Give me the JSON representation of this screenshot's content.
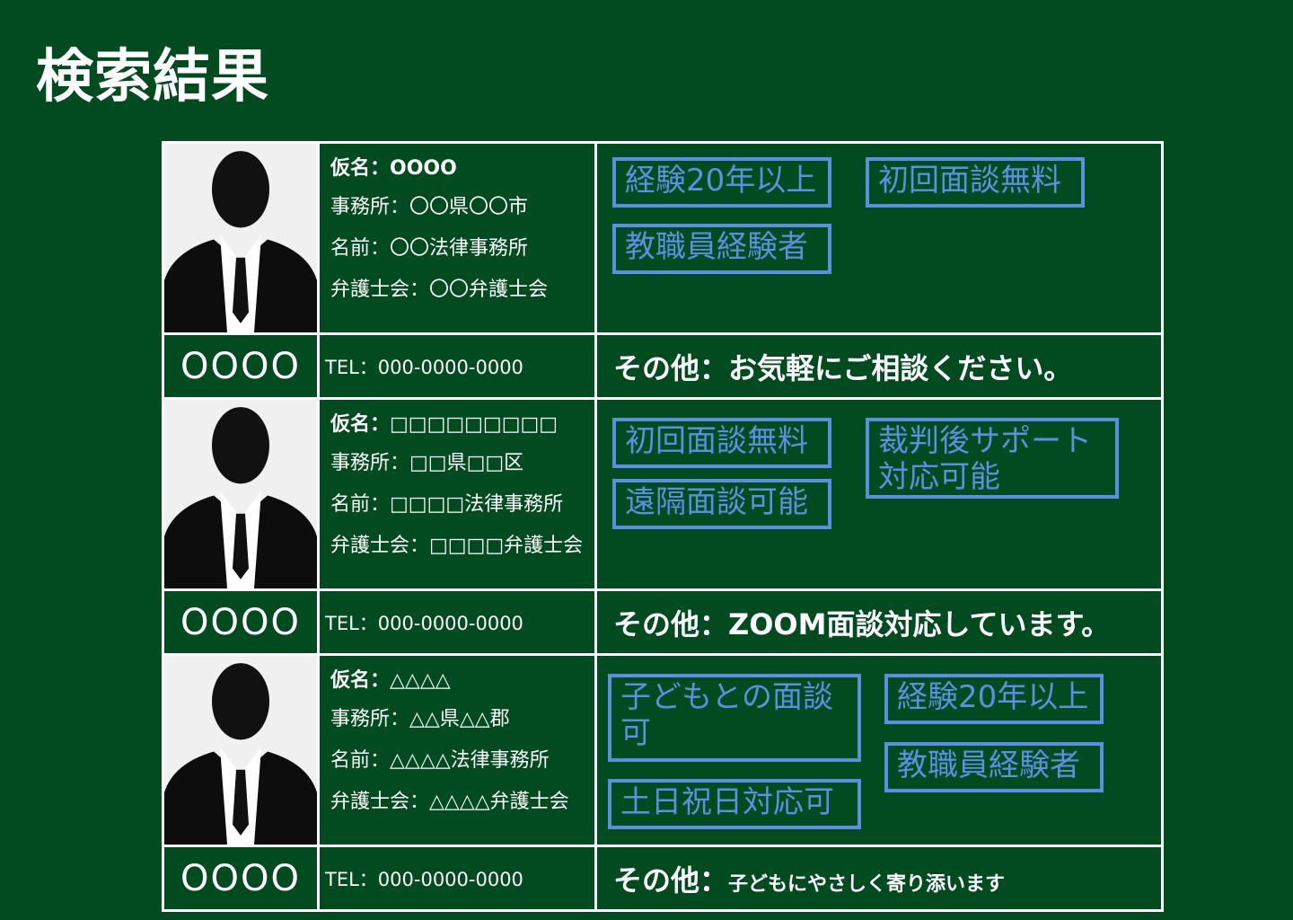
{
  "page_title": "検索結果",
  "colors": {
    "background": "#024a1f",
    "tag_border": "#5b8fe0",
    "table_border": "#ffffff"
  },
  "results": [
    {
      "alias": "仮名：OOOO",
      "office": "事務所：〇〇県〇〇市",
      "firm": "名前：〇〇法律事務所",
      "bar_association": "弁護士会：〇〇弁護士会",
      "tags": [
        "経験20年以上",
        "初回面談無料",
        "教職員経験者"
      ],
      "name": "OOOO",
      "tel": "TEL：000-0000-0000",
      "other_label": "その他：",
      "other_text": "お気軽にご相談ください。"
    },
    {
      "alias": "仮名：□□□□□□□□□",
      "office": "事務所：□□県□□区",
      "firm": "名前：□□□□法律事務所",
      "bar_association": "弁護士会：□□□□弁護士会",
      "tags": [
        "初回面談無料",
        "裁判後サポート対応可能",
        "遠隔面談可能"
      ],
      "name": "OOOO",
      "tel": "TEL：000-0000-0000",
      "other_label": "その他：",
      "other_text": "ZOOM面談対応しています。"
    },
    {
      "alias": "仮名：△△△△",
      "office": "事務所：△△県△△郡",
      "firm": "名前：△△△△法律事務所",
      "bar_association": "弁護士会：△△△△弁護士会",
      "tags": [
        "子どもとの面談可",
        "経験20年以上",
        "教職員経験者",
        "土日祝日対応可"
      ],
      "name": "OOOO",
      "tel": "TEL：000-0000-0000",
      "other_label": "その他：",
      "other_text": "子どもにやさしく寄り添います"
    }
  ]
}
